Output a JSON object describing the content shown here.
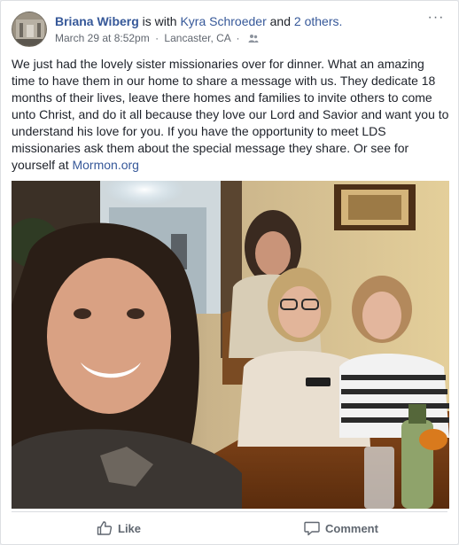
{
  "post": {
    "author": "Briana Wiberg",
    "with_text": "is with",
    "tagged": "Kyra Schroeder",
    "and_text": "and",
    "others": "2 others.",
    "date": "March 29 at 8:52pm",
    "location": "Lancaster, CA",
    "audience_icon": "friends-icon",
    "more_icon": "more-icon",
    "more_glyph": "···",
    "text_main": "We just had the lovely sister missionaries over for dinner. What an amazing time to have them in our home to share a message with us. They dedicate 18 months of their lives, leave there homes and families to invite others to come unto Christ, and do it all because they love our Lord and Savior and want you to understand his love for you. If you have the opportunity to meet LDS missionaries ask them about the special message they share. Or see for yourself at",
    "link": "Mormon.org",
    "photo_alt": "selfie"
  },
  "actions": {
    "like_label": "Like",
    "comment_label": "Comment"
  },
  "colors": {
    "link": "#365899",
    "meta": "#616770",
    "action": "#606770"
  }
}
